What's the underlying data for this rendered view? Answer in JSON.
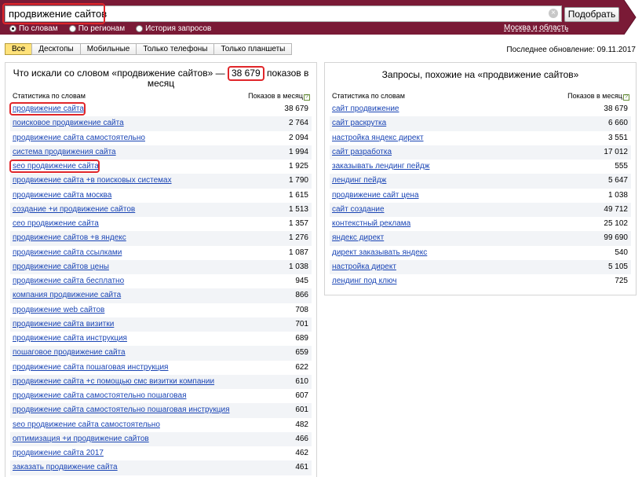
{
  "search": {
    "query": "продвижение сайтов",
    "submit_label": "Подобрать",
    "clear_symbol": "×"
  },
  "modes": [
    {
      "label": "По словам",
      "selected": true
    },
    {
      "label": "По регионам",
      "selected": false
    },
    {
      "label": "История запросов",
      "selected": false
    }
  ],
  "region_link": "Москва и область",
  "tabs": [
    {
      "label": "Все",
      "active": true
    },
    {
      "label": "Десктопы",
      "active": false
    },
    {
      "label": "Мобильные",
      "active": false
    },
    {
      "label": "Только телефоны",
      "active": false
    },
    {
      "label": "Только планшеты",
      "active": false
    }
  ],
  "last_update": "Последнее обновление: 09.11.2017",
  "left_panel": {
    "title_before": "Что искали со словом «продвижение сайтов» — ",
    "total": "38 679",
    "title_after": " показов в месяц",
    "col_phrase": "Статистика по словам",
    "col_count": "Показов в месяц",
    "help_mark": "?",
    "rows": [
      {
        "phrase": "продвижение сайта",
        "count": "38 679"
      },
      {
        "phrase": "поисковое продвижение сайта",
        "count": "2 764"
      },
      {
        "phrase": "продвижение сайта самостоятельно",
        "count": "2 094"
      },
      {
        "phrase": "система продвижения сайта",
        "count": "1 994"
      },
      {
        "phrase": "seo продвижение сайта",
        "count": "1 925"
      },
      {
        "phrase": "продвижение сайта +в поисковых системах",
        "count": "1 790"
      },
      {
        "phrase": "продвижение сайта москва",
        "count": "1 615"
      },
      {
        "phrase": "создание +и продвижение сайтов",
        "count": "1 513"
      },
      {
        "phrase": "сео продвижение сайта",
        "count": "1 357"
      },
      {
        "phrase": "продвижение сайтов +в яндекс",
        "count": "1 276"
      },
      {
        "phrase": "продвижение сайта ссылками",
        "count": "1 087"
      },
      {
        "phrase": "продвижение сайтов цены",
        "count": "1 038"
      },
      {
        "phrase": "продвижение сайта бесплатно",
        "count": "945"
      },
      {
        "phrase": "компания продвижение сайта",
        "count": "866"
      },
      {
        "phrase": "продвижение web сайтов",
        "count": "708"
      },
      {
        "phrase": "продвижение сайта визитки",
        "count": "701"
      },
      {
        "phrase": "продвижение сайта инструкция",
        "count": "689"
      },
      {
        "phrase": "пошаговое продвижение сайта",
        "count": "659"
      },
      {
        "phrase": "продвижение сайта пошаговая инструкция",
        "count": "622"
      },
      {
        "phrase": "продвижение сайта +с помощью смс визитки компании",
        "count": "610"
      },
      {
        "phrase": "продвижение сайта самостоятельно пошаговая",
        "count": "607"
      },
      {
        "phrase": "продвижение сайта самостоятельно пошаговая инструкция",
        "count": "601"
      },
      {
        "phrase": "seo продвижение сайта самостоятельно",
        "count": "482"
      },
      {
        "phrase": "оптимизация +и продвижение сайтов",
        "count": "466"
      },
      {
        "phrase": "продвижение сайта 2017",
        "count": "462"
      },
      {
        "phrase": "заказать продвижение сайта",
        "count": "461"
      }
    ]
  },
  "right_panel": {
    "title": "Запросы, похожие на «продвижение сайтов»",
    "col_phrase": "Статистика по словам",
    "col_count": "Показов в месяц",
    "help_mark": "?",
    "rows": [
      {
        "phrase": "сайт продвижение",
        "count": "38 679"
      },
      {
        "phrase": "сайт раскрутка",
        "count": "6 660"
      },
      {
        "phrase": "настройка яндекс директ",
        "count": "3 551"
      },
      {
        "phrase": "сайт разработка",
        "count": "17 012"
      },
      {
        "phrase": "заказывать лендинг пейдж",
        "count": "555"
      },
      {
        "phrase": "лендинг пейдж",
        "count": "5 647"
      },
      {
        "phrase": "продвижение сайт цена",
        "count": "1 038"
      },
      {
        "phrase": "сайт создание",
        "count": "49 712"
      },
      {
        "phrase": "контекстный реклама",
        "count": "25 102"
      },
      {
        "phrase": "яндекс директ",
        "count": "99 690"
      },
      {
        "phrase": "директ заказывать яндекс",
        "count": "540"
      },
      {
        "phrase": "настройка директ",
        "count": "5 105"
      },
      {
        "phrase": "лендинг под ключ",
        "count": "725"
      }
    ]
  },
  "colors": {
    "header_band": "#7a1a36",
    "link": "#1a45b5",
    "highlight": "#e0262a",
    "tab_active": "#ffe27a"
  }
}
